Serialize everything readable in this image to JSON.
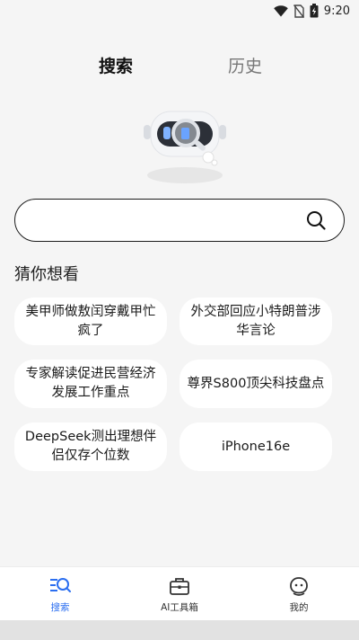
{
  "status_bar": {
    "time": "9:20",
    "icons": [
      "wifi-icon",
      "no-sim-icon",
      "battery-icon"
    ]
  },
  "tabs": [
    {
      "label": "搜索",
      "active": true
    },
    {
      "label": "历史",
      "active": false
    }
  ],
  "search": {
    "value": "",
    "placeholder": ""
  },
  "suggestions": {
    "title": "猜你想看",
    "items": [
      {
        "text": "美甲师做敖闰穿戴甲忙疯了"
      },
      {
        "text": "外交部回应小特朗普涉华言论"
      },
      {
        "text": "专家解读促进民营经济发展工作重点"
      },
      {
        "text": "尊界S800顶尖科技盘点"
      },
      {
        "text": "DeepSeek测出理想伴侣仅存个位数"
      },
      {
        "text": "iPhone16e"
      }
    ]
  },
  "bottom_nav": [
    {
      "label": "搜索",
      "icon": "search-list-icon",
      "active": true
    },
    {
      "label": "AI工具箱",
      "icon": "toolbox-icon",
      "active": false
    },
    {
      "label": "我的",
      "icon": "profile-icon",
      "active": false
    }
  ],
  "colors": {
    "accent": "#2b6ef0",
    "background": "#f5f5f5"
  }
}
